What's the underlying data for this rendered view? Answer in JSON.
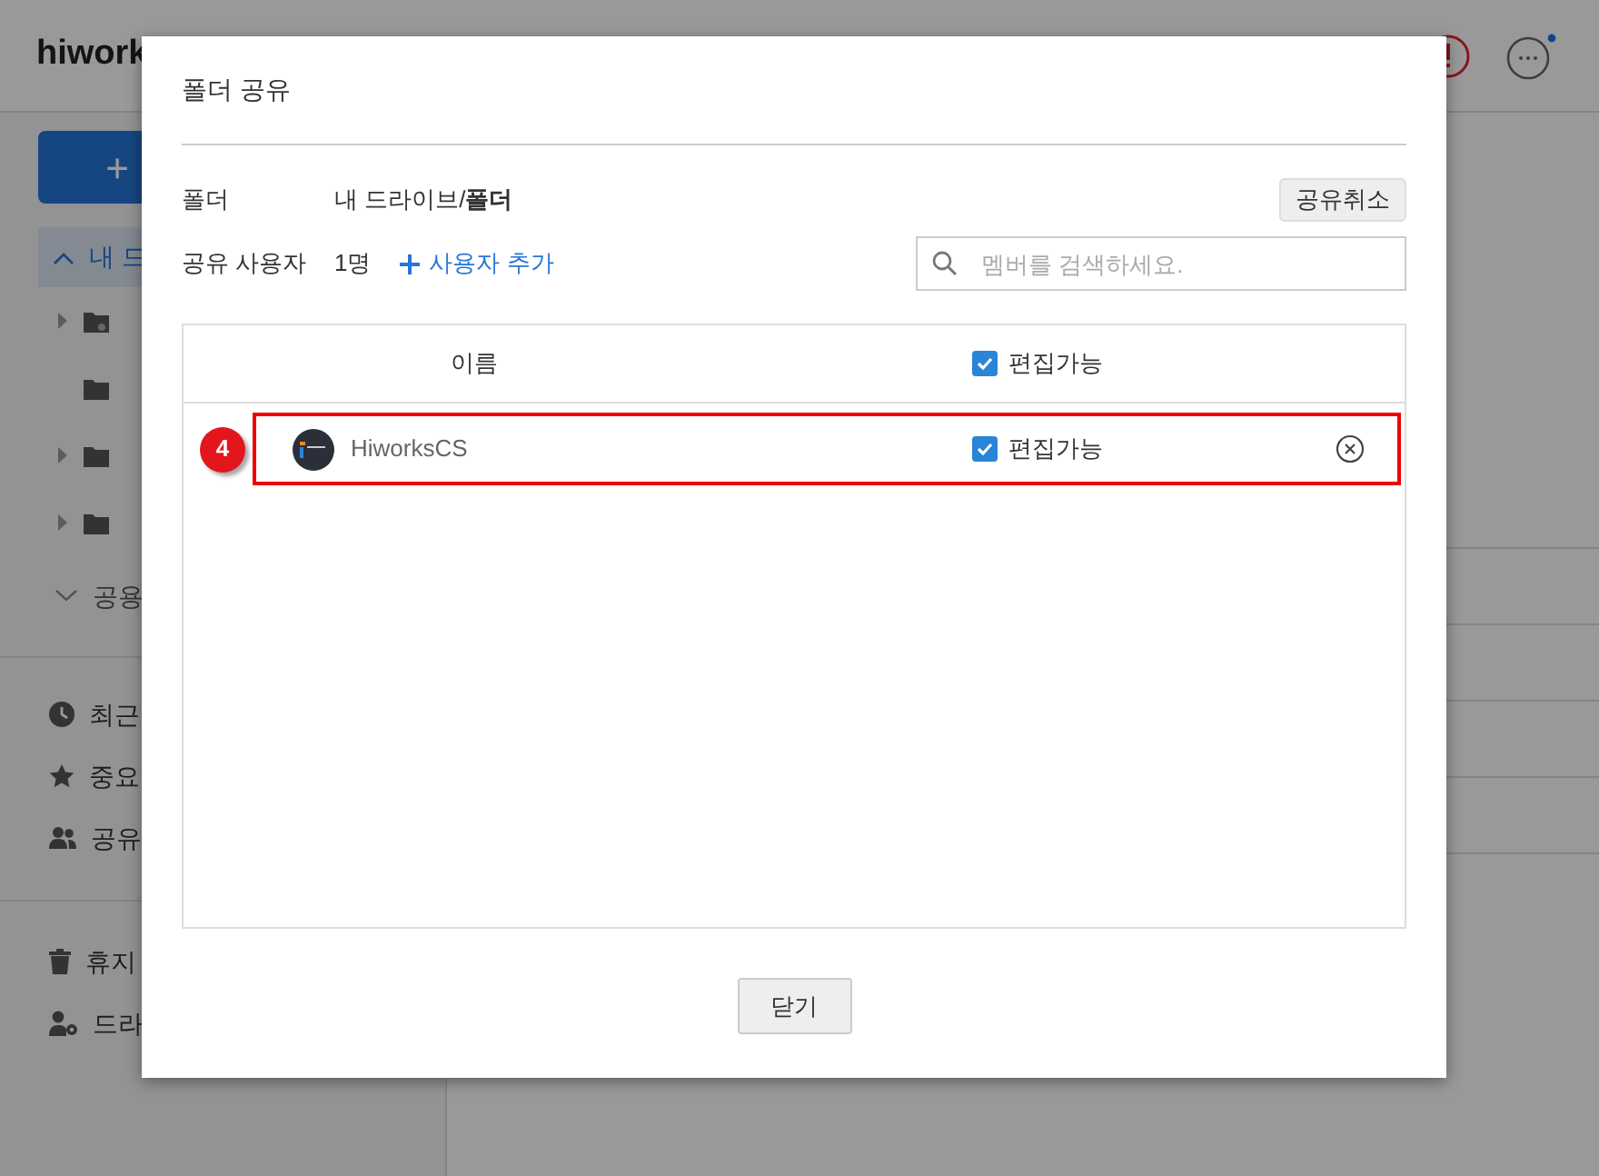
{
  "header": {
    "logo": "hiwork",
    "notification_dot": true
  },
  "sidebar": {
    "new_button": "+",
    "drive": {
      "label": "내 드",
      "expanded": true,
      "selected": true,
      "children": [
        {
          "has_children": true,
          "kind": "shared-folder"
        },
        {
          "has_children": false,
          "kind": "folder"
        },
        {
          "has_children": true,
          "kind": "folder"
        },
        {
          "has_children": true,
          "kind": "folder"
        }
      ]
    },
    "shared_drive": {
      "label": "공용",
      "expanded": false
    },
    "nav": [
      {
        "label": "최근",
        "kind": "clock"
      },
      {
        "label": "중요",
        "kind": "star"
      },
      {
        "label": "공유",
        "kind": "people"
      }
    ],
    "nav_bottom": [
      {
        "label": "휴지",
        "kind": "trash"
      },
      {
        "label": "드라",
        "kind": "user-settings"
      }
    ]
  },
  "dialog": {
    "title": "폴더 공유",
    "folder_label": "폴더",
    "folder_path": "내 드라이브/**폴더**",
    "unshare_button": "공유취소",
    "users_label": "공유 사용자",
    "users_count": "1명",
    "add_user_link": "사용자 추가",
    "search": {
      "placeholder": "멤버를 검색하세요."
    },
    "table": {
      "columns": [
        "이름",
        "편집가능"
      ],
      "all_editable_checked": true,
      "rows": [
        {
          "name": "HiworksCS",
          "editable": true,
          "editable_label": "편집가능",
          "highlighted": true,
          "callout": "4"
        }
      ]
    },
    "close_button": "닫기"
  }
}
